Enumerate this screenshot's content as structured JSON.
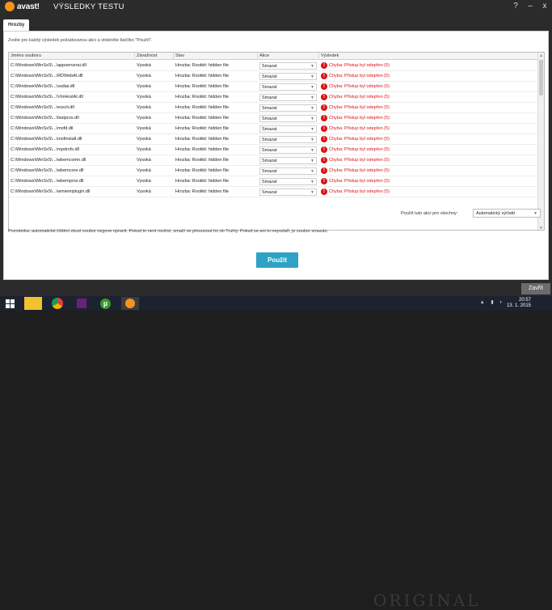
{
  "titlebar": {
    "logo": "avast!",
    "title": "VÝSLEDKY TESTU",
    "controls": [
      "?",
      "–",
      "x"
    ]
  },
  "tabs": [
    {
      "label": "Hrozby"
    }
  ],
  "instructions": "Zvolte pro každý výsledek požadovanou akci a stiskněte tlačítko \"Použít\".",
  "table": {
    "columns": [
      "Jméno souboru",
      "Závažnost",
      "Stav",
      "Akce",
      "Výsledek"
    ],
    "rows": [
      {
        "file": "C:\\Windows\\WinSxS\\...\\appserverai.dll",
        "severity": "Vysoká",
        "status": "Hrozba: Rootkit: hidden file",
        "action": "Smazat",
        "result": "Chyba: Přístup byl odepřen (5)"
      },
      {
        "file": "C:\\Windows\\WinSxS\\...\\RDWebAI.dll",
        "severity": "Vysoká",
        "status": "Hrozba: Rootkit: hidden file",
        "action": "Smazat",
        "result": "Chyba: Přístup byl odepřen (5)"
      },
      {
        "file": "C:\\Windows\\WinSxS\\...\\ssdiai.dll",
        "severity": "Vysoká",
        "status": "Hrozba: Rootkit: hidden file",
        "action": "Smazat",
        "result": "Chyba: Přístup byl odepřen (5)"
      },
      {
        "file": "C:\\Windows\\WinSxS\\...\\VmHostAI.dll",
        "severity": "Vysoká",
        "status": "Hrozba: Rootkit: hidden file",
        "action": "Smazat",
        "result": "Chyba: Přístup byl odepřen (5)"
      },
      {
        "file": "C:\\Windows\\WinSxS\\...\\esscli.dll",
        "severity": "Vysoká",
        "status": "Hrozba: Rootkit: hidden file",
        "action": "Smazat",
        "result": "Chyba: Přístup byl odepřen (5)"
      },
      {
        "file": "C:\\Windows\\WinSxS\\...\\fastprox.dll",
        "severity": "Vysoká",
        "status": "Hrozba: Rootkit: hidden file",
        "action": "Smazat",
        "result": "Chyba: Přístup byl odepřen (5)"
      },
      {
        "file": "C:\\Windows\\WinSxS\\...\\mofd.dll",
        "severity": "Vysoká",
        "status": "Hrozba: Rootkit: hidden file",
        "action": "Smazat",
        "result": "Chyba: Přístup byl odepřen (5)"
      },
      {
        "file": "C:\\Windows\\WinSxS\\...\\mofinstall.dll",
        "severity": "Vysoká",
        "status": "Hrozba: Rootkit: hidden file",
        "action": "Smazat",
        "result": "Chyba: Přístup byl odepřen (5)"
      },
      {
        "file": "C:\\Windows\\WinSxS\\...\\repdrvfs.dll",
        "severity": "Vysoká",
        "status": "Hrozba: Rootkit: hidden file",
        "action": "Smazat",
        "result": "Chyba: Přístup byl odepřen (5)"
      },
      {
        "file": "C:\\Windows\\WinSxS\\...\\wbemcomn.dll",
        "severity": "Vysoká",
        "status": "Hrozba: Rootkit: hidden file",
        "action": "Smazat",
        "result": "Chyba: Přístup byl odepřen (5)"
      },
      {
        "file": "C:\\Windows\\WinSxS\\...\\wbemcore.dll",
        "severity": "Vysoká",
        "status": "Hrozba: Rootkit: hidden file",
        "action": "Smazat",
        "result": "Chyba: Přístup byl odepřen (5)"
      },
      {
        "file": "C:\\Windows\\WinSxS\\...\\wbemprox.dll",
        "severity": "Vysoká",
        "status": "Hrozba: Rootkit: hidden file",
        "action": "Smazat",
        "result": "Chyba: Přístup byl odepřen (5)"
      },
      {
        "file": "C:\\Windows\\WinSxS\\...\\wmiemiplugin.dll",
        "severity": "Vysoká",
        "status": "Hrozba: Rootkit: hidden file",
        "action": "Smazat",
        "result": "Chyba: Přístup byl odepřen (5)"
      }
    ]
  },
  "apply_all": {
    "label": "Použít tuto akci pro všechny:",
    "value": "Automatický výčistit"
  },
  "note": "Poznámka: automatické čištění zkusí soubor nejprve opravit. Pokud to není možné, smaží se přesunout ho do Truhly. Pokud se ani to nepodaří, je soubor smazán.",
  "apply_button": "Použít",
  "close_button": "Zavřít",
  "taskbar": {
    "time": "20:57",
    "date": "13. 1. 2015",
    "wallpaper_text": "ORIGINAL"
  },
  "colors": {
    "accent": "#2ea3c5",
    "error": "#dd1111",
    "brand": "#f7941d"
  }
}
